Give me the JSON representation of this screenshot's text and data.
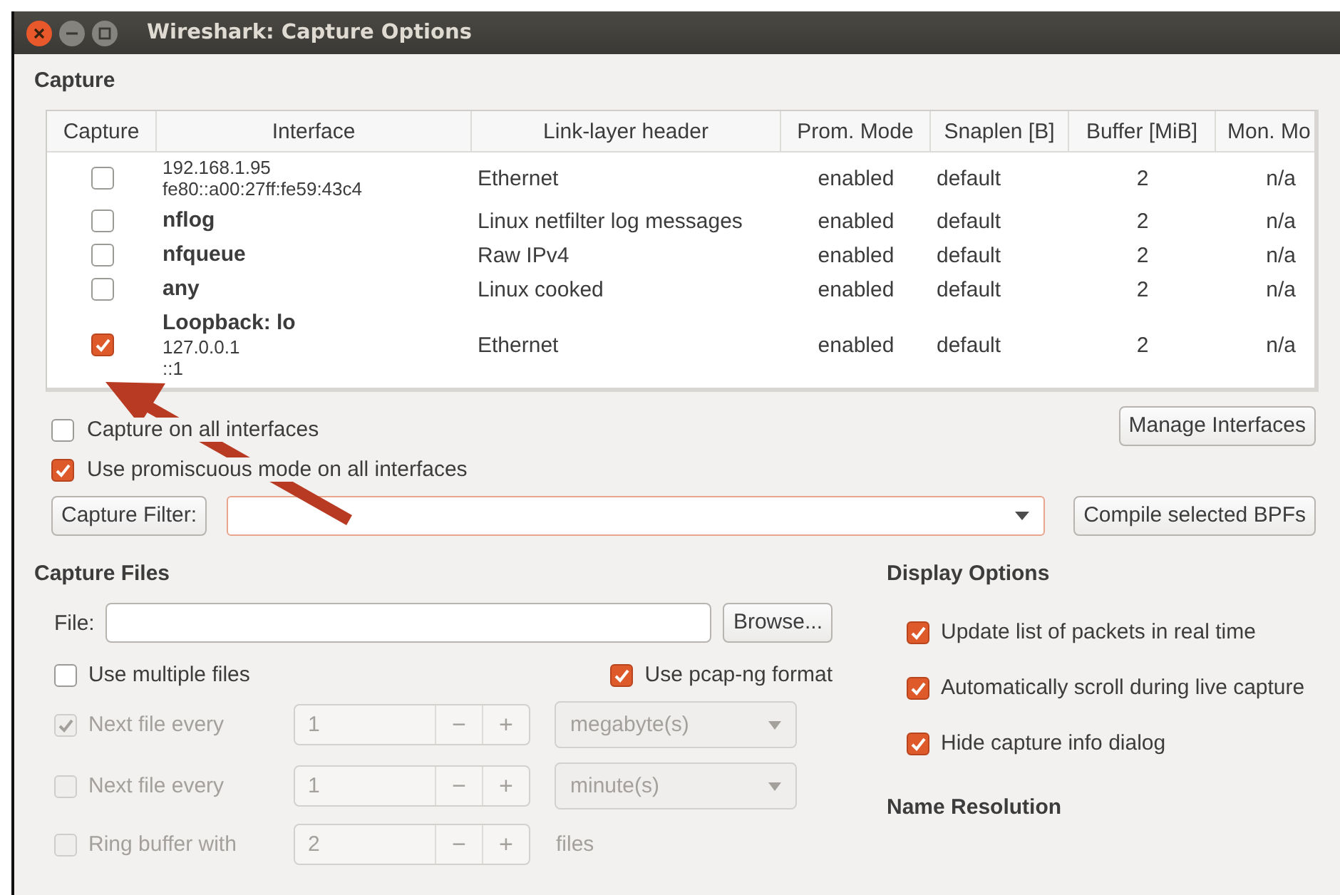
{
  "window": {
    "title": "Wireshark: Capture Options"
  },
  "capture": {
    "heading": "Capture",
    "columns": [
      "Capture",
      "Interface",
      "Link-layer header",
      "Prom. Mode",
      "Snaplen [B]",
      "Buffer [MiB]",
      "Mon. Mo"
    ],
    "rows": [
      {
        "checked": false,
        "lines": [
          "192.168.1.95",
          "fe80::a00:27ff:fe59:43c4"
        ],
        "link": "Ethernet",
        "prom": "enabled",
        "snaplen": "default",
        "buffer": "2",
        "mon": "n/a"
      },
      {
        "checked": false,
        "name": "nflog",
        "link": "Linux netfilter log messages",
        "prom": "enabled",
        "snaplen": "default",
        "buffer": "2",
        "mon": "n/a"
      },
      {
        "checked": false,
        "name": "nfqueue",
        "link": "Raw IPv4",
        "prom": "enabled",
        "snaplen": "default",
        "buffer": "2",
        "mon": "n/a"
      },
      {
        "checked": false,
        "name": "any",
        "link": "Linux cooked",
        "prom": "enabled",
        "snaplen": "default",
        "buffer": "2",
        "mon": "n/a"
      },
      {
        "checked": true,
        "name": "Loopback: lo",
        "lines": [
          "127.0.0.1",
          "::1"
        ],
        "link": "Ethernet",
        "prom": "enabled",
        "snaplen": "default",
        "buffer": "2",
        "mon": "n/a"
      }
    ],
    "all_interfaces": {
      "label": "Capture on all interfaces",
      "checked": false
    },
    "promiscuous": {
      "label": "Use promiscuous mode on all interfaces",
      "checked": true
    },
    "manage_button": "Manage Interfaces",
    "filter_button": "Capture Filter:",
    "compile_button": "Compile selected BPFs"
  },
  "capture_files": {
    "heading": "Capture Files",
    "file_label": "File:",
    "browse_button": "Browse...",
    "multiple_files": {
      "label": "Use multiple files",
      "checked": false
    },
    "pcapng": {
      "label": "Use pcap-ng format",
      "checked": true
    },
    "rows": [
      {
        "checked": true,
        "disabled": true,
        "label": "Next file every",
        "value": "1",
        "decrement": "−",
        "increment": "+",
        "unit": {
          "kind": "dropdown",
          "text": "megabyte(s)"
        }
      },
      {
        "checked": false,
        "disabled": true,
        "label": "Next file every",
        "value": "1",
        "decrement": "−",
        "increment": "+",
        "unit": {
          "kind": "dropdown",
          "text": "minute(s)"
        }
      },
      {
        "checked": false,
        "disabled": true,
        "label": "Ring buffer with",
        "value": "2",
        "decrement": "−",
        "increment": "+",
        "unit": {
          "kind": "label",
          "text": "files"
        }
      }
    ]
  },
  "display_options": {
    "heading": "Display Options",
    "items": [
      {
        "label": "Update list of packets in real time",
        "checked": true
      },
      {
        "label": "Automatically scroll during live capture",
        "checked": true
      },
      {
        "label": "Hide capture info dialog",
        "checked": true
      }
    ]
  },
  "name_resolution": {
    "heading": "Name Resolution"
  }
}
